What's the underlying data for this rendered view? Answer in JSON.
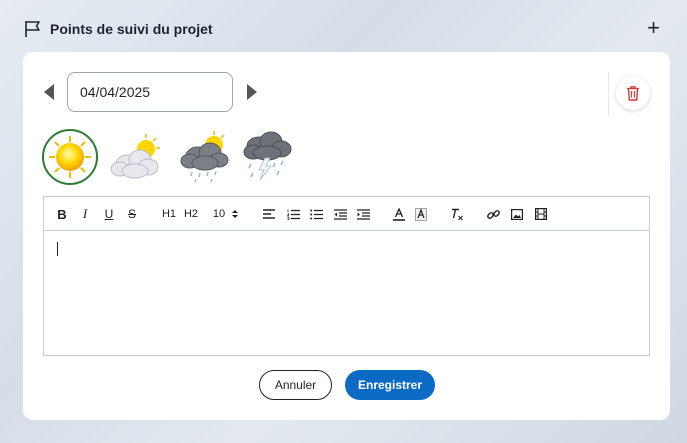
{
  "header": {
    "title": "Points de suivi du projet",
    "add_icon": "plus-icon",
    "flag_icon": "flag-icon"
  },
  "date_nav": {
    "value": "04/04/2025",
    "prev_icon": "triangle-left-icon",
    "next_icon": "triangle-right-icon"
  },
  "delete_icon": "trash-icon",
  "weather": {
    "selected": "sunny",
    "options": [
      "sunny",
      "partly-cloudy",
      "cloudy-rain",
      "storm"
    ]
  },
  "toolbar": {
    "font_size": "10",
    "h1": "H1",
    "h2": "H2"
  },
  "editor": {
    "content": ""
  },
  "actions": {
    "cancel_label": "Annuler",
    "save_label": "Enregistrer"
  },
  "colors": {
    "accent": "#0b6bc4",
    "delete": "#d23b3b",
    "selected_ring": "#2f7a33"
  }
}
